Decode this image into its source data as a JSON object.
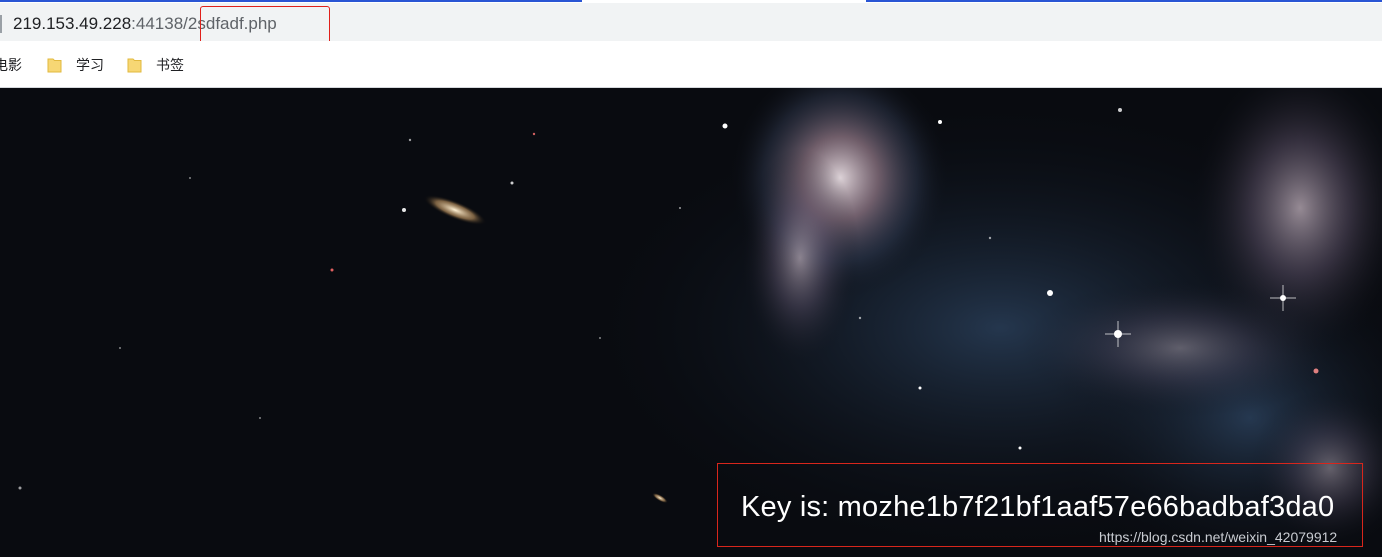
{
  "browser": {
    "url": {
      "host": "219.153.49.228",
      "port": ":44138/",
      "path": "2sdfadf.php"
    },
    "bookmarks": [
      {
        "label": "电影",
        "icon": "folder-icon"
      },
      {
        "label": "学习",
        "icon": "folder-icon"
      },
      {
        "label": "书签",
        "icon": "folder-icon"
      }
    ]
  },
  "page": {
    "key_text": "Key is: mozhe1b7f21bf1aaf57e66badbaf3da0",
    "watermark": "https://blog.csdn.net/weixin_42079912"
  },
  "colors": {
    "annotation_red": "#e0201a",
    "address_bar_bg": "#f1f3f4",
    "space_bg": "#090b10",
    "tab_accent": "#2a55d4"
  }
}
